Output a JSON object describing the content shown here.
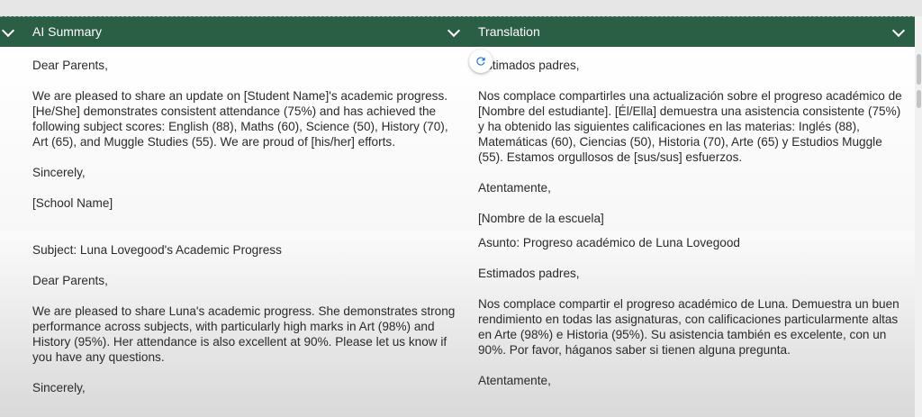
{
  "header": {
    "col1_title": "AI Summary",
    "col2_title": "Translation"
  },
  "rows": [
    {
      "summary": "Dear Parents,\n\nWe are pleased to share an update on [Student Name]'s academic progress.  [He/She] demonstrates consistent attendance (75%) and has achieved the following subject scores: English (88), Maths (60), Science (50), History (70), Art (65), and Muggle Studies (55).  We are proud of [his/her] efforts.\n\nSincerely,\n\n[School Name]",
      "translation": "Estimados padres,\n\nNos complace compartirles una actualización sobre el progreso académico de [Nombre del estudiante]. [Él/Ella] demuestra una asistencia consistente (75%) y ha obtenido las siguientes calificaciones en las materias: Inglés (88), Matemáticas (60), Ciencias (50), Historia (70), Arte (65) y Estudios Muggle (55). Estamos orgullosos de [sus/sus] esfuerzos.\n\nAtentamente,\n\n[Nombre de la escuela]"
    },
    {
      "summary": "Subject: Luna Lovegood's Academic Progress\n\nDear Parents,\n\nWe are pleased to share Luna's academic progress.  She demonstrates strong performance across subjects, with particularly high marks in Art (98%) and History (95%). Her attendance is also excellent at 90%.  Please let us know if you have any questions.\n\nSincerely,",
      "translation": "Asunto: Progreso académico de Luna Lovegood\n\nEstimados padres,\n\nNos complace compartir el progreso académico de Luna. Demuestra un buen rendimiento en todas las asignaturas, con calificaciones particularmente altas en Arte (98%) e Historia (95%). Su asistencia también es excelente, con un 90%. Por favor, háganos saber si tienen alguna pregunta.\n\nAtentamente,"
    }
  ],
  "icons": {
    "collapse": "chevron-down-icon",
    "sort": "chevron-down-icon",
    "refresh": "refresh-icon"
  },
  "colors": {
    "header_bg": "#2a5e45",
    "header_text": "#ffffff",
    "refresh_icon": "#1a73e8"
  }
}
